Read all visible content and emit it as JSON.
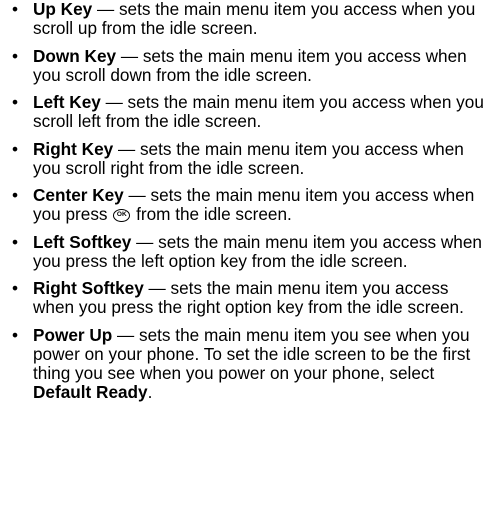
{
  "items": [
    {
      "term": "Up Key",
      "text": " — sets the main menu item you access when you scroll up from the idle screen."
    },
    {
      "term": "Down Key",
      "text": " — sets the main menu item you access when you scroll down from the idle screen."
    },
    {
      "term": "Left Key",
      "text": " — sets the main menu item you access when you scroll left from the idle screen."
    },
    {
      "term": "Right Key",
      "text": " — sets the main menu item you access when you scroll right from the idle screen."
    },
    {
      "term": "Center Key",
      "text_before_icon": " — sets the main menu item you access when you press ",
      "icon": "ok-key-icon",
      "text_after_icon": " from the idle screen."
    },
    {
      "term": "Left Softkey",
      "text": " — sets the main menu item you access when you press the left option key from the idle screen."
    },
    {
      "term": "Right Softkey",
      "text": " — sets the main menu item you access when you press the right option key from the idle screen."
    },
    {
      "term": "Power Up",
      "text": " — sets the main menu item you see when you power on your phone. To set the idle screen to be the first thing you see when you power on your phone, select ",
      "emphasis": "Default Ready",
      "text_end": "."
    }
  ]
}
